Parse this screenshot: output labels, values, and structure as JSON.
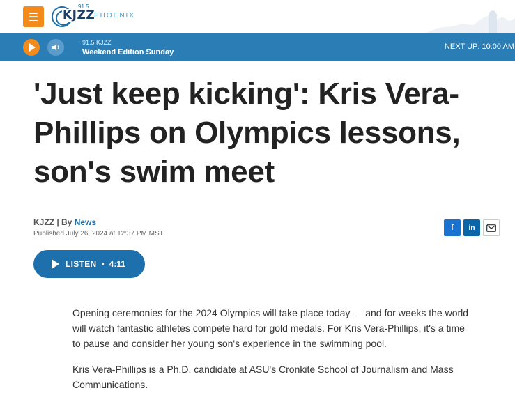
{
  "header": {
    "logo": {
      "frequency": "91.5",
      "wordmark": "KJZZ",
      "city": "PHOENIX"
    }
  },
  "player": {
    "station": "91.5 KJZZ",
    "show": "Weekend Edition Sunday",
    "next_up": "NEXT UP: 10:00 AM"
  },
  "article": {
    "headline": "'Just keep kicking': Kris Vera-Phillips on Olympics lessons, son's swim meet",
    "byline": {
      "org": "KJZZ",
      "sep": " | By ",
      "author": "News"
    },
    "published": "Published July 26, 2024 at 12:37 PM MST",
    "share": {
      "facebook": "f",
      "linkedin": "in"
    },
    "listen": {
      "label": "LISTEN",
      "dot": "•",
      "duration": "4:11"
    },
    "paragraphs": [
      "Opening ceremonies for the 2024 Olympics will take place today — and for weeks the world will watch fantastic athletes compete hard for gold medals. For Kris Vera-Phillips, it's a time to pause and consider her young son's experience in the swimming pool.",
      "Kris Vera-Phillips is a Ph.D. candidate at ASU's Cronkite School of Journalism and Mass Communications."
    ]
  },
  "colors": {
    "accent_orange": "#f28b1c",
    "player_blue": "#2b7db5",
    "listen_blue": "#1e70ad",
    "link_blue": "#1c6fa8"
  },
  "icons": [
    "menu-icon",
    "play-icon",
    "volume-icon",
    "facebook-icon",
    "linkedin-icon",
    "email-icon"
  ]
}
